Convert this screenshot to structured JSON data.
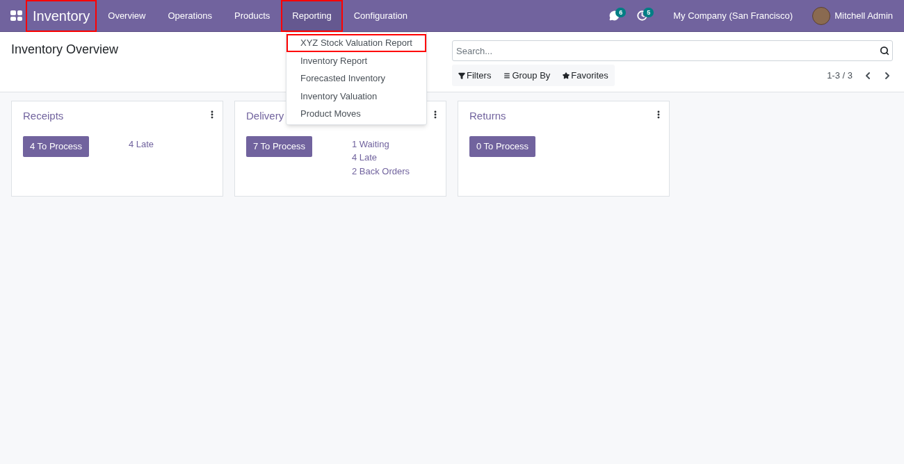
{
  "navbar": {
    "app_name": {
      "label": "Inventory",
      "highlighted": true
    },
    "menu": [
      {
        "label": "Overview",
        "selected": false,
        "highlighted": false
      },
      {
        "label": "Operations",
        "selected": false,
        "highlighted": false
      },
      {
        "label": "Products",
        "selected": false,
        "highlighted": false
      },
      {
        "label": "Reporting",
        "selected": true,
        "highlighted": true
      },
      {
        "label": "Configuration",
        "selected": false,
        "highlighted": false
      }
    ],
    "messages_count": "6",
    "activities_count": "5",
    "company": "My Company (San Francisco)",
    "user": "Mitchell Admin"
  },
  "dropdown": [
    {
      "label": "XYZ Stock Valuation Report",
      "highlighted": true
    },
    {
      "label": "Inventory Report",
      "highlighted": false
    },
    {
      "label": "Forecasted Inventory",
      "highlighted": false
    },
    {
      "label": "Inventory Valuation",
      "highlighted": false
    },
    {
      "label": "Product Moves",
      "highlighted": false
    }
  ],
  "control_panel": {
    "title": "Inventory Overview",
    "search": {
      "placeholder": "Search..."
    },
    "filters": [
      "Filters",
      "Group By",
      "Favorites"
    ],
    "pager": "1-3 / 3"
  },
  "cards": [
    {
      "title": "Receipts",
      "button": "4 To Process",
      "links": [
        "4 Late"
      ]
    },
    {
      "title": "Delivery",
      "button": "7 To Process",
      "links": [
        "1 Waiting",
        "4 Late",
        "2 Back Orders"
      ]
    },
    {
      "title": "Returns",
      "button": "0 To Process"
    }
  ]
}
